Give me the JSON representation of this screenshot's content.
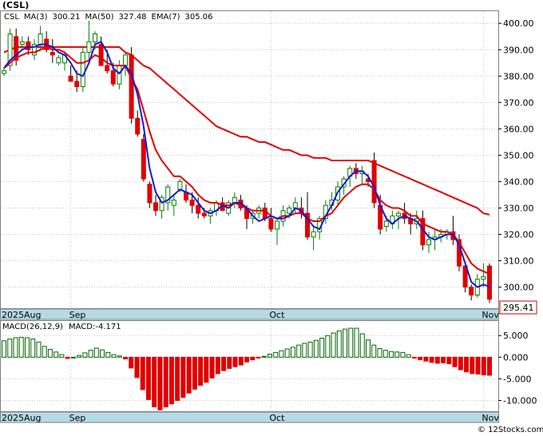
{
  "header": {
    "title": "(CSL)"
  },
  "price_panel": {
    "legend": [
      {
        "text": "CSL",
        "color": "#000000"
      },
      {
        "text": "MA(3)",
        "color": "#1a1acc"
      },
      {
        "text": "300.21",
        "color": "#000000"
      },
      {
        "text": "MA(50)",
        "color": "#1a1acc"
      },
      {
        "text": "327.48",
        "color": "#000000"
      },
      {
        "text": "EMA(7)",
        "color": "#1a1acc"
      },
      {
        "text": "305.06",
        "color": "#000000"
      }
    ],
    "last_price_tag": "295.41"
  },
  "macd_panel": {
    "legend_name": "MACD(26,12,9)",
    "legend_value": "MACD:-4.171"
  },
  "axis_labels": {
    "month_aug": "2025Aug",
    "month_sep": "Sep",
    "month_oct": "Oct",
    "month_nov": "Nov"
  },
  "watermark": "© 12Stocks.com",
  "colors": {
    "up": "#008000",
    "down": "#e00000",
    "ma3": "#1a1acc",
    "ma50": "#e00000",
    "band": "#b4dbe6",
    "grid": "#c8c8c8",
    "macd_pos": "#006400",
    "macd_neg": "#e00000"
  },
  "chart_data": [
    {
      "type": "candlestick",
      "title": "CSL",
      "x_months": [
        {
          "label": "2025Aug",
          "index": 0
        },
        {
          "label": "Sep",
          "index": 11
        },
        {
          "label": "Oct",
          "index": 44
        },
        {
          "label": "Nov",
          "index": 79
        }
      ],
      "ylim": [
        292,
        404
      ],
      "yticks": [
        300,
        310,
        320,
        330,
        340,
        350,
        360,
        370,
        380,
        390,
        400
      ],
      "ytick_labels": [
        "300.00",
        "310.00",
        "320.00",
        "330.00",
        "340.00",
        "350.00",
        "360.00",
        "370.00",
        "380.00",
        "390.00",
        "400.00"
      ],
      "grid": true,
      "candles": [
        {
          "o": 381,
          "h": 383,
          "l": 380,
          "c": 382
        },
        {
          "o": 384,
          "h": 398,
          "l": 382,
          "c": 396
        },
        {
          "o": 395,
          "h": 398,
          "l": 384,
          "c": 386
        },
        {
          "o": 392,
          "h": 395,
          "l": 390,
          "c": 393
        },
        {
          "o": 393,
          "h": 395,
          "l": 388,
          "c": 390
        },
        {
          "o": 388,
          "h": 394,
          "l": 386,
          "c": 392
        },
        {
          "o": 392,
          "h": 399,
          "l": 390,
          "c": 396
        },
        {
          "o": 394,
          "h": 397,
          "l": 389,
          "c": 390
        },
        {
          "o": 389,
          "h": 394,
          "l": 385,
          "c": 388
        },
        {
          "o": 385,
          "h": 388,
          "l": 384,
          "c": 387
        },
        {
          "o": 385,
          "h": 389,
          "l": 382,
          "c": 388
        },
        {
          "o": 380,
          "h": 384,
          "l": 378,
          "c": 378
        },
        {
          "o": 378,
          "h": 382,
          "l": 374,
          "c": 376
        },
        {
          "o": 376,
          "h": 391,
          "l": 374,
          "c": 389
        },
        {
          "o": 389,
          "h": 401,
          "l": 386,
          "c": 393
        },
        {
          "o": 393,
          "h": 397,
          "l": 390,
          "c": 396
        },
        {
          "o": 392,
          "h": 395,
          "l": 384,
          "c": 384
        },
        {
          "o": 384,
          "h": 390,
          "l": 381,
          "c": 382
        },
        {
          "o": 382,
          "h": 385,
          "l": 376,
          "c": 377
        },
        {
          "o": 377,
          "h": 386,
          "l": 375,
          "c": 384
        },
        {
          "o": 384,
          "h": 389,
          "l": 380,
          "c": 388
        },
        {
          "o": 388,
          "h": 391,
          "l": 362,
          "c": 364
        },
        {
          "o": 364,
          "h": 367,
          "l": 357,
          "c": 358
        },
        {
          "o": 356,
          "h": 358,
          "l": 340,
          "c": 341
        },
        {
          "o": 339,
          "h": 340,
          "l": 330,
          "c": 332
        },
        {
          "o": 332,
          "h": 335,
          "l": 327,
          "c": 329
        },
        {
          "o": 329,
          "h": 335,
          "l": 326,
          "c": 334
        },
        {
          "o": 332,
          "h": 339,
          "l": 329,
          "c": 338
        },
        {
          "o": 331,
          "h": 335,
          "l": 327,
          "c": 333
        },
        {
          "o": 337,
          "h": 341,
          "l": 336,
          "c": 340
        },
        {
          "o": 336,
          "h": 339,
          "l": 332,
          "c": 333
        },
        {
          "o": 333,
          "h": 336,
          "l": 328,
          "c": 331
        },
        {
          "o": 331,
          "h": 334,
          "l": 326,
          "c": 328
        },
        {
          "o": 328,
          "h": 330,
          "l": 326,
          "c": 327
        },
        {
          "o": 327,
          "h": 330,
          "l": 324,
          "c": 329
        },
        {
          "o": 329,
          "h": 333,
          "l": 327,
          "c": 332
        },
        {
          "o": 332,
          "h": 334,
          "l": 329,
          "c": 329
        },
        {
          "o": 328,
          "h": 333,
          "l": 327,
          "c": 332
        },
        {
          "o": 332,
          "h": 336,
          "l": 330,
          "c": 334
        },
        {
          "o": 333,
          "h": 335,
          "l": 329,
          "c": 330
        },
        {
          "o": 330,
          "h": 331,
          "l": 322,
          "c": 326
        },
        {
          "o": 326,
          "h": 329,
          "l": 324,
          "c": 328
        },
        {
          "o": 328,
          "h": 331,
          "l": 326,
          "c": 330
        },
        {
          "o": 330,
          "h": 332,
          "l": 325,
          "c": 326
        },
        {
          "o": 326,
          "h": 330,
          "l": 321,
          "c": 322
        },
        {
          "o": 322,
          "h": 326,
          "l": 316,
          "c": 325
        },
        {
          "o": 325,
          "h": 331,
          "l": 323,
          "c": 329
        },
        {
          "o": 328,
          "h": 331,
          "l": 326,
          "c": 330
        },
        {
          "o": 330,
          "h": 334,
          "l": 328,
          "c": 332
        },
        {
          "o": 330,
          "h": 334,
          "l": 326,
          "c": 328
        },
        {
          "o": 328,
          "h": 336,
          "l": 318,
          "c": 319
        },
        {
          "o": 319,
          "h": 323,
          "l": 314,
          "c": 321
        },
        {
          "o": 321,
          "h": 327,
          "l": 318,
          "c": 326
        },
        {
          "o": 326,
          "h": 333,
          "l": 324,
          "c": 331
        },
        {
          "o": 331,
          "h": 336,
          "l": 329,
          "c": 333
        },
        {
          "o": 333,
          "h": 340,
          "l": 331,
          "c": 338
        },
        {
          "o": 338,
          "h": 342,
          "l": 335,
          "c": 341
        },
        {
          "o": 342,
          "h": 346,
          "l": 338,
          "c": 345
        },
        {
          "o": 345,
          "h": 347,
          "l": 341,
          "c": 343
        },
        {
          "o": 343,
          "h": 346,
          "l": 339,
          "c": 344
        },
        {
          "o": 341,
          "h": 343,
          "l": 338,
          "c": 340
        },
        {
          "o": 348,
          "h": 351,
          "l": 330,
          "c": 332
        },
        {
          "o": 331,
          "h": 335,
          "l": 320,
          "c": 322
        },
        {
          "o": 323,
          "h": 327,
          "l": 321,
          "c": 325
        },
        {
          "o": 324,
          "h": 329,
          "l": 322,
          "c": 327
        },
        {
          "o": 327,
          "h": 329,
          "l": 322,
          "c": 328
        },
        {
          "o": 328,
          "h": 332,
          "l": 324,
          "c": 326
        },
        {
          "o": 326,
          "h": 328,
          "l": 320,
          "c": 324
        },
        {
          "o": 324,
          "h": 329,
          "l": 322,
          "c": 326
        },
        {
          "o": 326,
          "h": 329,
          "l": 314,
          "c": 316
        },
        {
          "o": 316,
          "h": 321,
          "l": 313,
          "c": 318
        },
        {
          "o": 318,
          "h": 322,
          "l": 314,
          "c": 319
        },
        {
          "o": 319,
          "h": 322,
          "l": 317,
          "c": 320
        },
        {
          "o": 320,
          "h": 322,
          "l": 318,
          "c": 321
        },
        {
          "o": 321,
          "h": 327,
          "l": 316,
          "c": 318
        },
        {
          "o": 318,
          "h": 320,
          "l": 306,
          "c": 308
        },
        {
          "o": 308,
          "h": 309,
          "l": 298,
          "c": 300
        },
        {
          "o": 300,
          "h": 301,
          "l": 295,
          "c": 297
        },
        {
          "o": 297,
          "h": 305,
          "l": 296,
          "c": 303
        },
        {
          "o": 303,
          "h": 309,
          "l": 300,
          "c": 304
        },
        {
          "o": 308,
          "h": 309,
          "l": 294,
          "c": 295.41
        }
      ],
      "ema7": [
        383,
        385,
        387,
        388,
        389,
        389,
        390,
        391,
        390,
        390,
        389,
        387,
        385,
        385,
        386,
        388,
        387,
        385,
        384,
        384,
        384,
        379,
        375,
        367,
        359,
        352,
        348,
        345,
        342,
        342,
        340,
        338,
        335,
        333,
        332,
        332,
        331,
        331,
        332,
        331,
        330,
        329,
        329,
        329,
        327,
        326,
        327,
        327,
        328,
        328,
        326,
        325,
        325,
        327,
        328,
        331,
        334,
        336,
        338,
        339,
        339,
        337,
        333,
        331,
        330,
        330,
        329,
        327,
        327,
        324,
        323,
        322,
        321,
        321,
        320,
        317,
        313,
        309,
        307,
        306,
        305.06
      ],
      "ma3": [
        383,
        386,
        388,
        390,
        391,
        391,
        392,
        392,
        391,
        389,
        388,
        385,
        381,
        380,
        385,
        392,
        393,
        389,
        383,
        381,
        384,
        381,
        373,
        361,
        345,
        336,
        332,
        333,
        335,
        337,
        336,
        335,
        332,
        329,
        328,
        329,
        331,
        330,
        332,
        332,
        330,
        327,
        325,
        326,
        327,
        326,
        326,
        327,
        330,
        329,
        326,
        323,
        322,
        327,
        331,
        336,
        339,
        342,
        344,
        344,
        342,
        338,
        331,
        326,
        324,
        326,
        327,
        326,
        325,
        322,
        319,
        318,
        319,
        320,
        320,
        316,
        309,
        302,
        300,
        301,
        300.21
      ],
      "ma50": [
        389,
        390,
        391,
        391,
        391,
        391,
        391,
        391,
        391,
        391,
        391,
        391,
        391,
        391,
        391,
        391,
        391,
        391,
        391,
        391,
        389,
        388,
        386,
        384,
        383,
        381,
        379,
        377,
        375,
        373,
        371,
        369,
        367,
        365,
        363,
        361,
        360,
        359,
        358,
        357,
        357,
        356,
        355,
        355,
        354,
        353,
        352,
        352,
        351,
        350,
        350,
        349,
        349,
        349,
        348,
        348,
        348,
        348,
        348,
        348,
        348,
        347,
        346,
        345,
        344,
        343,
        342,
        341,
        340,
        339,
        338,
        337,
        336,
        335,
        334,
        333,
        332,
        331,
        330,
        328,
        327.48
      ]
    },
    {
      "type": "bar",
      "title": "MACD(26,12,9)",
      "ylim": [
        -12.5,
        8
      ],
      "yticks": [
        5,
        0,
        -5,
        -10
      ],
      "ytick_labels": [
        "5.000",
        "0.000",
        "-5.000",
        "-10.000"
      ],
      "values": [
        3.8,
        4.2,
        4.5,
        4.6,
        4.5,
        4.2,
        3.5,
        2.5,
        1.8,
        1.2,
        0.6,
        -0.3,
        0,
        0.4,
        1.0,
        1.6,
        2.1,
        1.7,
        1.1,
        0.6,
        0.3,
        -0.4,
        -2.5,
        -4.7,
        -7.5,
        -9.8,
        -11.5,
        -12.2,
        -11.5,
        -10.8,
        -10.0,
        -9.3,
        -8.3,
        -7.4,
        -6.5,
        -5.8,
        -4.8,
        -3.8,
        -3.1,
        -2.6,
        -2.2,
        -1.8,
        -1.1,
        -0.6,
        -0.2,
        0.2,
        0.7,
        1.1,
        1.5,
        1.9,
        2.3,
        2.8,
        3.2,
        3.5,
        3.9,
        4.4,
        5.0,
        5.6,
        6.1,
        6.5,
        6.7,
        6.7,
        5.4,
        4.0,
        2.8,
        2.0,
        1.6,
        1.3,
        1.2,
        1.1,
        0.6,
        -0.2,
        -0.6,
        -0.9,
        -1.2,
        -1.4,
        -1.3,
        -1.5,
        -2.2,
        -2.9,
        -3.4,
        -3.8,
        -3.9,
        -4.1,
        -4.171
      ]
    }
  ]
}
